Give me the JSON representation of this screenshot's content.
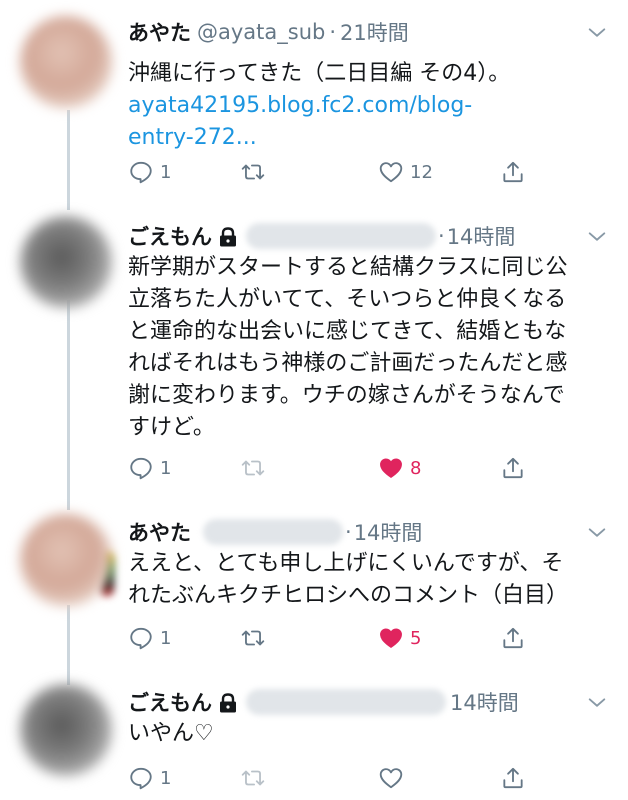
{
  "tweets": [
    {
      "name": "あやた",
      "handle": "@ayata_sub",
      "dot": "·",
      "time": "21時間",
      "lines": [
        "沖縄に行ってきた（二日目編 その4）。"
      ],
      "link_lines": [
        "ayata42195.blog.fc2.com/blog-",
        "entry-272..."
      ],
      "reply_count": "1",
      "retweet_count": "",
      "like_count": "12",
      "liked": false
    },
    {
      "name": "ごえもん",
      "handle": "",
      "dot": "·",
      "time": "14時間",
      "lines": [
        "新学期がスタートすると結構クラスに同じ公",
        "立落ちた人がいてて、そいつらと仲良くなる",
        "と運命的な出会いに感じてきて、結婚ともな",
        "ればそれはもう神様のご計画だったんだと感",
        "謝に変わります。ウチの嫁さんがそうなんで",
        "すけど。"
      ],
      "reply_count": "1",
      "retweet_count": "",
      "like_count": "8",
      "liked": true
    },
    {
      "name": "あやた",
      "handle": "",
      "dot": "·",
      "time": "14時間",
      "lines": [
        "ええと、とても申し上げにくいんですが、そ",
        "れたぶんキクチヒロシへのコメント（白目）"
      ],
      "reply_count": "1",
      "retweet_count": "",
      "like_count": "5",
      "liked": true
    },
    {
      "name": "ごえもん",
      "handle": "",
      "dot": "",
      "time": "14時間",
      "lines": [
        "いやん♡"
      ],
      "reply_count": "1",
      "retweet_count": "",
      "like_count": "",
      "liked": false
    }
  ],
  "icons": {
    "reply": "reply-icon",
    "retweet": "retweet-icon",
    "like": "heart-icon",
    "share": "share-icon",
    "lock": "lock-icon",
    "more": "chevron-down-icon"
  },
  "colors": {
    "text": "#14171a",
    "muted": "#657786",
    "link": "#1b95e0",
    "like": "#e0245e",
    "thread_line": "#ccd6dd"
  }
}
